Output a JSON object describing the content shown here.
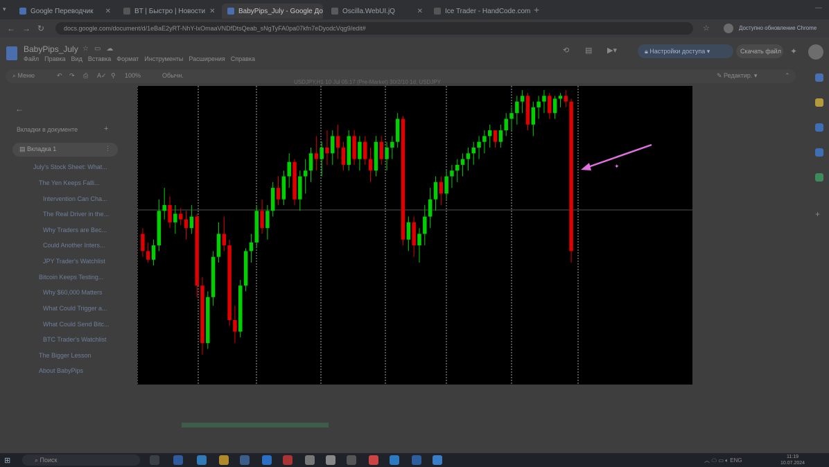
{
  "tabs": [
    {
      "label": "Google Переводчик",
      "color": "#4a6fb0",
      "active": false
    },
    {
      "label": "BT | Быстро | Новости",
      "color": "#555",
      "active": false
    },
    {
      "label": "BabyPips_July - Google Докум",
      "color": "#4a6fb0",
      "active": true
    },
    {
      "label": "Oscilla.WebUI.jQ",
      "color": "#5a5a5a",
      "active": false
    },
    {
      "label": "Ice Trader - HandCode.com",
      "color": "#555",
      "active": false
    }
  ],
  "address": {
    "url": "docs.google.com/document/d/1eBaE2yRT-NhY-lxOmaaVNDfDtsQeab_sNgTyFA0pa07kfn7eDyodcVqg9/edit#",
    "update_label": "Доступно обновление Chrome"
  },
  "doc": {
    "title": "BabyPips_July",
    "menu": [
      "Файл",
      "Правка",
      "Вид",
      "Вставка",
      "Формат",
      "Инструменты",
      "Расширения",
      "Справка"
    ],
    "access_button": "Настройки доступа",
    "share_button": "Скачать файл",
    "toolbar": {
      "search": "Меню",
      "zoom": "100%",
      "style": "Обычн.",
      "editing": "Редактир."
    }
  },
  "sidebar": {
    "heading": "Вкладки в документе",
    "tab_label": "Вкладка 1",
    "outline": [
      "July's Stock Sheet: What...",
      "The Yen Keeps Falli...",
      "Intervention Can Cha...",
      "The Real Driver in the...",
      "Why Traders are Bec...",
      "Could Another Inters...",
      "JPY Trader's Watchlist",
      "Bitcoin Keeps Testing...",
      "Why $60,000 Matters",
      "What Could Trigger a...",
      "What Could Send Bitc...",
      "BTC Trader's Watchlist",
      "The Bigger Lesson",
      "About BabyPips"
    ]
  },
  "chart_header": "USDJPY,H1 10 Jul 05:17 (Pre-Market) 30/2/10 1d, USDJPY",
  "chart_data": {
    "type": "candlestick",
    "title": "",
    "xlabel": "",
    "ylabel": "",
    "colors": {
      "up": "#00d000",
      "down": "#e00000",
      "background": "#000000",
      "grid": "#cfcfcf",
      "annotation": "#e070e0"
    },
    "grid": "vertical dotted session separators",
    "annotation": "pink arrow pointing at final large bearish candle",
    "ylim": [
      0,
      100
    ],
    "ohlc": [
      [
        50,
        52,
        42,
        44
      ],
      [
        44,
        47,
        40,
        41
      ],
      [
        41,
        48,
        39,
        46
      ],
      [
        46,
        62,
        44,
        58
      ],
      [
        58,
        66,
        55,
        60
      ],
      [
        60,
        63,
        52,
        54
      ],
      [
        54,
        60,
        50,
        57
      ],
      [
        57,
        59,
        53,
        55
      ],
      [
        55,
        58,
        48,
        52
      ],
      [
        52,
        60,
        50,
        56
      ],
      [
        56,
        57,
        28,
        32
      ],
      [
        32,
        35,
        8,
        12
      ],
      [
        12,
        30,
        10,
        28
      ],
      [
        28,
        44,
        25,
        42
      ],
      [
        42,
        54,
        40,
        50
      ],
      [
        50,
        56,
        44,
        46
      ],
      [
        46,
        48,
        18,
        20
      ],
      [
        20,
        25,
        12,
        16
      ],
      [
        16,
        34,
        14,
        32
      ],
      [
        32,
        45,
        30,
        44
      ],
      [
        44,
        50,
        40,
        47
      ],
      [
        47,
        60,
        45,
        58
      ],
      [
        58,
        62,
        50,
        52
      ],
      [
        52,
        60,
        48,
        58
      ],
      [
        58,
        68,
        56,
        66
      ],
      [
        66,
        70,
        60,
        62
      ],
      [
        62,
        72,
        60,
        70
      ],
      [
        70,
        78,
        66,
        75
      ],
      [
        75,
        76,
        60,
        62
      ],
      [
        62,
        72,
        58,
        70
      ],
      [
        70,
        76,
        64,
        72
      ],
      [
        72,
        80,
        68,
        78
      ],
      [
        78,
        84,
        72,
        76
      ],
      [
        76,
        82,
        70,
        80
      ],
      [
        80,
        86,
        74,
        78
      ],
      [
        78,
        86,
        74,
        84
      ],
      [
        84,
        88,
        76,
        80
      ],
      [
        80,
        82,
        72,
        74
      ],
      [
        74,
        86,
        72,
        84
      ],
      [
        84,
        86,
        74,
        76
      ],
      [
        76,
        84,
        72,
        82
      ],
      [
        82,
        84,
        74,
        76
      ],
      [
        76,
        80,
        68,
        72
      ],
      [
        72,
        84,
        70,
        82
      ],
      [
        82,
        84,
        74,
        76
      ],
      [
        76,
        82,
        72,
        80
      ],
      [
        80,
        84,
        76,
        82
      ],
      [
        82,
        92,
        80,
        90
      ],
      [
        90,
        91,
        46,
        48
      ],
      [
        48,
        56,
        44,
        54
      ],
      [
        54,
        56,
        42,
        46
      ],
      [
        46,
        52,
        40,
        50
      ],
      [
        50,
        60,
        46,
        56
      ],
      [
        56,
        66,
        52,
        62
      ],
      [
        62,
        70,
        58,
        68
      ],
      [
        68,
        70,
        60,
        64
      ],
      [
        64,
        72,
        62,
        70
      ],
      [
        70,
        74,
        66,
        72
      ],
      [
        72,
        76,
        68,
        74
      ],
      [
        74,
        78,
        70,
        76
      ],
      [
        76,
        80,
        72,
        78
      ],
      [
        78,
        82,
        74,
        80
      ],
      [
        80,
        84,
        76,
        82
      ],
      [
        82,
        86,
        78,
        84
      ],
      [
        84,
        88,
        80,
        86
      ],
      [
        86,
        84,
        80,
        82
      ],
      [
        82,
        88,
        80,
        86
      ],
      [
        86,
        92,
        84,
        90
      ],
      [
        90,
        94,
        86,
        92
      ],
      [
        92,
        98,
        88,
        96
      ],
      [
        96,
        100,
        92,
        98
      ],
      [
        98,
        99,
        86,
        88
      ],
      [
        88,
        96,
        84,
        94
      ],
      [
        94,
        98,
        90,
        96
      ],
      [
        96,
        100,
        92,
        98
      ],
      [
        98,
        99,
        90,
        92
      ],
      [
        92,
        98,
        90,
        97
      ],
      [
        97,
        99,
        94,
        98
      ],
      [
        98,
        100,
        94,
        96
      ],
      [
        96,
        97,
        40,
        44
      ]
    ]
  },
  "taskbar": {
    "search": "Поиск",
    "tray": "ENG",
    "time": "11:19",
    "date": "10.07.2024"
  }
}
